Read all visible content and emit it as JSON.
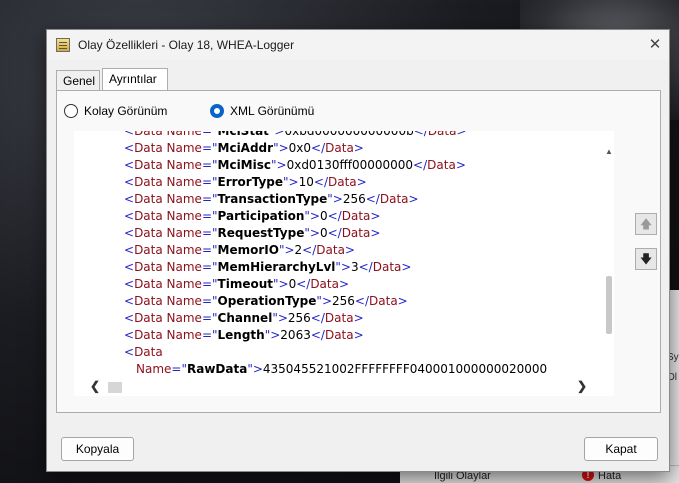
{
  "background": {
    "right_panel_fragments": [
      "Sy",
      "Ol"
    ],
    "bottom_bar": {
      "related_events": "İlgili Olaylar",
      "error_label": "Hata"
    }
  },
  "dialog": {
    "title": "Olay Özellikleri - Olay 18, WHEA-Logger",
    "close_glyph": "✕",
    "tabs": [
      {
        "label": "Genel",
        "active": false
      },
      {
        "label": "Ayrıntılar",
        "active": true
      }
    ],
    "view_options": {
      "easy_view": "Kolay Görünüm",
      "xml_view": "XML Görünümü",
      "selected": "xml_view"
    },
    "xml": {
      "element": "Data",
      "attr": "Name",
      "rows": [
        {
          "name": "MciStat",
          "value": "0xbd000000000000b",
          "partial": true
        },
        {
          "name": "MciAddr",
          "value": "0x0"
        },
        {
          "name": "MciMisc",
          "value": "0xd0130fff00000000"
        },
        {
          "name": "ErrorType",
          "value": "10"
        },
        {
          "name": "TransactionType",
          "value": "256"
        },
        {
          "name": "Participation",
          "value": "0"
        },
        {
          "name": "RequestType",
          "value": "0"
        },
        {
          "name": "MemorIO",
          "value": "2"
        },
        {
          "name": "MemHierarchyLvl",
          "value": "3"
        },
        {
          "name": "Timeout",
          "value": "0"
        },
        {
          "name": "OperationType",
          "value": "256"
        },
        {
          "name": "Channel",
          "value": "256"
        },
        {
          "name": "Length",
          "value": "2063"
        }
      ],
      "raw_open": "Data",
      "raw_name": "RawData",
      "raw_value": "435045521002FFFFFFFF040001000000020000"
    },
    "scroll": {
      "up": "▲",
      "down": "▼",
      "left": "❮",
      "right": "❯"
    },
    "nav": {
      "prev_icon": "🡅",
      "next_icon": "🡇"
    },
    "buttons": {
      "copy": "Kopyala",
      "close": "Kapat"
    }
  }
}
